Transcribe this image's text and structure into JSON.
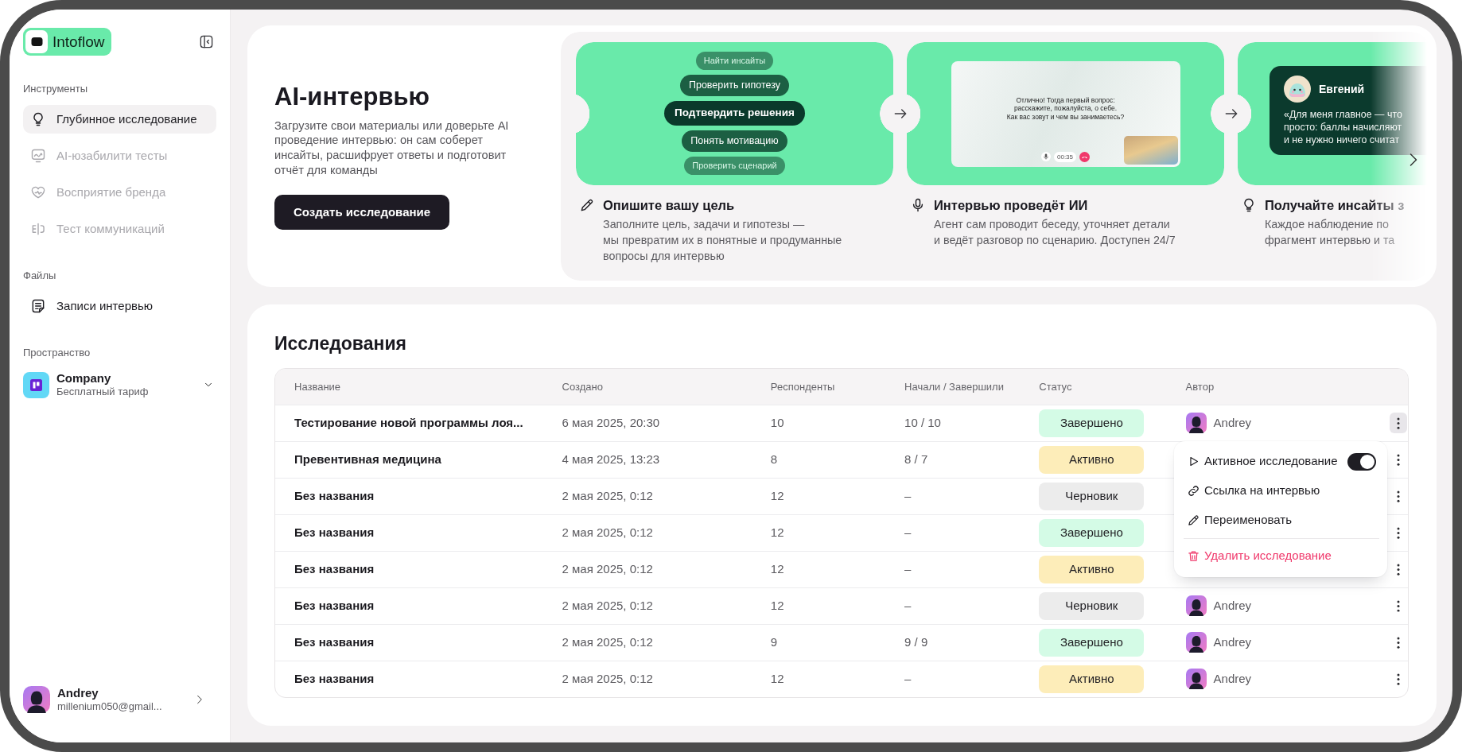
{
  "sidebar": {
    "brand": "Intoflow",
    "sections": [
      {
        "title": "Инструменты",
        "items": [
          {
            "label": "Глубинное исследование",
            "selected": true,
            "disabled": false
          },
          {
            "label": "AI-юзабилити тесты",
            "selected": false,
            "disabled": true
          },
          {
            "label": "Восприятие бренда",
            "selected": false,
            "disabled": true
          },
          {
            "label": "Тест коммуникаций",
            "selected": false,
            "disabled": true
          }
        ]
      },
      {
        "title": "Файлы",
        "items": [
          {
            "label": "Записи интервью",
            "selected": false,
            "disabled": false
          }
        ]
      }
    ],
    "workspace": {
      "title": "Пространство",
      "name": "Company",
      "plan": "Бесплатный тариф"
    },
    "user": {
      "name": "Andrey",
      "email": "millenium050@gmail..."
    }
  },
  "hero": {
    "title": "AI-интервью",
    "description": "Загрузите свои материалы или доверьте AI проведение интервью: он сам соберет инсайты, расшифрует ответы и подготовит отчёт для команды",
    "button": "Создать исследование",
    "steps": [
      {
        "kind": "chips",
        "title": "Опишите вашу цель",
        "lines": [
          "Заполните цель, задачи и гипотезы —",
          "мы превратим их в понятные и продуманные",
          "вопросы для интервью"
        ],
        "chips": [
          {
            "label": "Найти инсайты",
            "kind": "faint"
          },
          {
            "label": "Проверить гипотезу",
            "kind": "mid"
          },
          {
            "label": "Подтвердить решения",
            "kind": "main"
          },
          {
            "label": "Понять мотивацию",
            "kind": "mid"
          },
          {
            "label": "Проверить сценарий",
            "kind": "faint"
          }
        ]
      },
      {
        "kind": "call",
        "title": "Интервью проведёт ИИ",
        "lines": [
          "Агент сам проводит беседу, уточняет детали",
          "и ведёт разговор по сценарию. Доступен 24/7"
        ],
        "question": [
          "Отлично! Тогда первый вопрос:",
          "расскажите, пожалуйста, о себе.",
          "Как вас зовут и чем вы занимаетесь?"
        ],
        "timer": "00:35"
      },
      {
        "kind": "quote",
        "title": "Получайте инсайты з",
        "lines": [
          "Каждое наблюдение по",
          "фрагмент интервью и та"
        ],
        "author": "Евгений",
        "quote": [
          "«Для меня главное — что",
          "просто: баллы начисляют",
          "и не нужно ничего считат"
        ]
      }
    ]
  },
  "studies": {
    "title": "Исследования",
    "columns": [
      "Название",
      "Создано",
      "Респонденты",
      "Начали / Завершили",
      "Статус",
      "Автор"
    ],
    "rows": [
      {
        "name": "Тестирование новой программы лоя...",
        "created": "6 мая 2025, 20:30",
        "respondents": "10",
        "progress": "10 / 10",
        "status": {
          "label": "Завершено",
          "kind": "done"
        },
        "author": "Andrey",
        "menu_open": true
      },
      {
        "name": "Превентивная медицина",
        "created": "4 мая 2025, 13:23",
        "respondents": "8",
        "progress": "8 / 7",
        "status": {
          "label": "Активно",
          "kind": "active"
        },
        "menu_open": false
      },
      {
        "name": "Без названия",
        "created": "2 мая 2025, 0:12",
        "respondents": "12",
        "progress": "–",
        "status": {
          "label": "Черновик",
          "kind": "draft"
        },
        "menu_open": false
      },
      {
        "name": "Без названия",
        "created": "2 мая 2025, 0:12",
        "respondents": "12",
        "progress": "–",
        "status": {
          "label": "Завершено",
          "kind": "done"
        },
        "menu_open": false
      },
      {
        "name": "Без названия",
        "created": "2 мая 2025, 0:12",
        "respondents": "12",
        "progress": "–",
        "status": {
          "label": "Активно",
          "kind": "active"
        },
        "menu_open": false
      },
      {
        "name": "Без названия",
        "created": "2 мая 2025, 0:12",
        "respondents": "12",
        "progress": "–",
        "status": {
          "label": "Черновик",
          "kind": "draft"
        },
        "author": "Andrey",
        "menu_open": false
      },
      {
        "name": "Без названия",
        "created": "2 мая 2025, 0:12",
        "respondents": "9",
        "progress": "9 / 9",
        "status": {
          "label": "Завершено",
          "kind": "done"
        },
        "author": "Andrey",
        "menu_open": false
      },
      {
        "name": "Без названия",
        "created": "2 мая 2025, 0:12",
        "respondents": "12",
        "progress": "–",
        "status": {
          "label": "Активно",
          "kind": "active"
        },
        "author": "Andrey",
        "menu_open": false
      }
    ]
  },
  "context_menu": {
    "items": [
      {
        "kind": "toggle",
        "label": "Активное исследование",
        "on": true
      },
      {
        "kind": "plain",
        "label": "Ссылка на интервью"
      },
      {
        "kind": "plain",
        "label": "Переименовать"
      },
      {
        "kind": "danger",
        "label": "Удалить исследование"
      }
    ]
  }
}
